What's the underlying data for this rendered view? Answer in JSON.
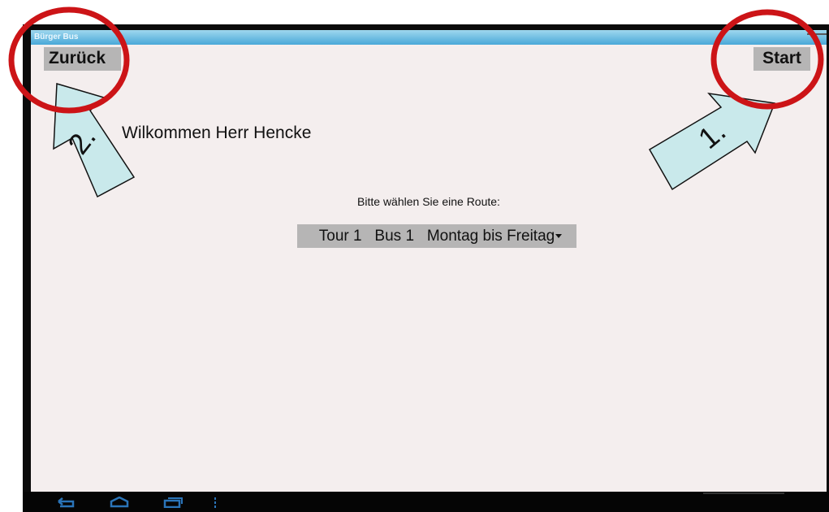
{
  "app": {
    "title": "Bürger Bus"
  },
  "nav": {
    "back_label": "Zurück",
    "start_label": "Start"
  },
  "main": {
    "welcome": "Wilkommen Herr Hencke",
    "route_prompt": "Bitte wählen Sie eine Route:",
    "route_selected": "Tour 1   Bus 1   Montag bis Freitag"
  },
  "system_bar": {
    "icons": [
      "back-icon",
      "home-icon",
      "recent-apps-icon",
      "menu-icon"
    ]
  },
  "annotations": {
    "marker_1": "1.",
    "marker_2": "2.",
    "circle_color": "#cc1417",
    "arrow_fill": "#c9e9eb"
  }
}
